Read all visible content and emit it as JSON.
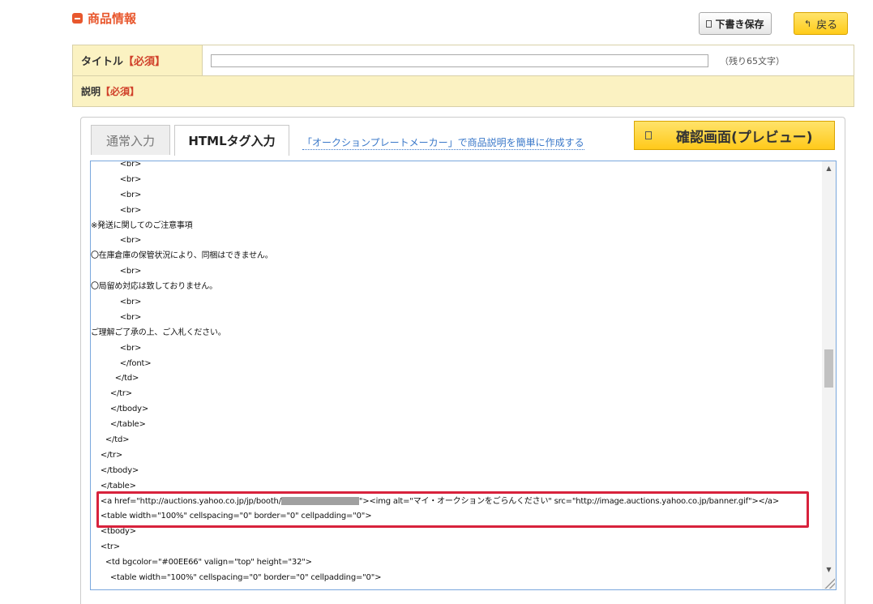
{
  "section": {
    "title": "商品情報"
  },
  "toolbar": {
    "draft_label": "下書き保存",
    "back_label": "戻る"
  },
  "form": {
    "title_label": "タイトル",
    "required_mark": "【必須】",
    "title_value": "",
    "remaining_text": "（残り65文字）",
    "description_label": "説明"
  },
  "editor": {
    "tabs": [
      {
        "label": "通常入力"
      },
      {
        "label": "HTMLタグ入力"
      }
    ],
    "maker_link": "「オークションプレートメーカー」で商品説明を簡単に作成する",
    "preview_label": "確認画面(プレビュー)",
    "code_lines": [
      "            <br>",
      "            <br>",
      "            <br>",
      "            <br>",
      "※発送に関してのご注意事項",
      "            <br>",
      "〇在庫倉庫の保管状況により、同梱はできません。",
      "            <br>",
      "〇局留め対応は致しておりません。",
      "            <br>",
      "            <br>",
      "ご理解ご了承の上、ご入札ください。",
      "            <br>",
      "            </font>",
      "          </td>",
      "        </tr>",
      "        </tbody>",
      "        </table>",
      "      </td>",
      "    </tr>",
      "    </tbody>",
      "    </table>",
      "    <a href=\"http://auctions.yahoo.co.jp/jp/booth/",
      "    <table width=\"100%\" cellspacing=\"0\" border=\"0\" cellpadding=\"0\">",
      "    <tbody>",
      "    <tr>",
      "      <td bgcolor=\"#00EE66\" valign=\"top\" height=\"32\">",
      "        <table width=\"100%\" cellspacing=\"0\" border=\"0\" cellpadding=\"0\">"
    ],
    "link_line_tail": "\"><img alt=\"マイ・オークションをごらんください\" src=\"http://image.auctions.yahoo.co.jp/banner.gif\"></a>"
  },
  "colors": {
    "accent": "#e8572d",
    "highlight": "#d8223c",
    "button_yellow": "#ffcc1a",
    "form_bg": "#fbf2c2"
  }
}
